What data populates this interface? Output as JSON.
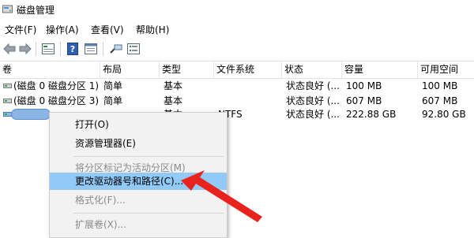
{
  "window": {
    "title": "磁盘管理"
  },
  "menu": [
    "文件(F)",
    "操作(A)",
    "查看(V)",
    "帮助(H)"
  ],
  "toolbar": {
    "icons": [
      "back-arrow-icon",
      "forward-arrow-icon",
      "disk-list-icon",
      "help-icon",
      "properties-icon",
      "connect-icon",
      "settings-list-icon"
    ]
  },
  "table": {
    "columns": [
      "卷",
      "布局",
      "类型",
      "文件系统",
      "状态",
      "容量",
      "可用空间"
    ],
    "rows": [
      {
        "name": "(磁盘 0 磁盘分区 1)",
        "layout": "简单",
        "type": "基本",
        "fs": "",
        "status": "状态良好 (...",
        "capacity": "100 MB",
        "free": "100 MB"
      },
      {
        "name": "(磁盘 0 磁盘分区 3)",
        "layout": "简单",
        "type": "基本",
        "fs": "",
        "status": "状态良好 (...",
        "capacity": "607 MB",
        "free": "607 MB"
      },
      {
        "name": "",
        "layout": "",
        "type": "基本",
        "fs": "NTFS",
        "status": "状态良好 (...",
        "capacity": "222.88 GB",
        "free": "92.80 GB"
      }
    ]
  },
  "context_menu": {
    "items": [
      {
        "label": "打开(O)",
        "enabled": true
      },
      {
        "label": "资源管理器(E)",
        "enabled": true
      },
      {
        "label": "将分区标记为活动分区(M)",
        "enabled": false
      },
      {
        "label": "更改驱动器号和路径(C)...",
        "enabled": true,
        "highlighted": true
      },
      {
        "label": "格式化(F)...",
        "enabled": false
      },
      {
        "label": "扩展卷(X)...",
        "enabled": false
      }
    ]
  },
  "colors": {
    "highlight": "#91c9f7",
    "arrow": "#e8231e",
    "selection": "#8bb5e6"
  }
}
